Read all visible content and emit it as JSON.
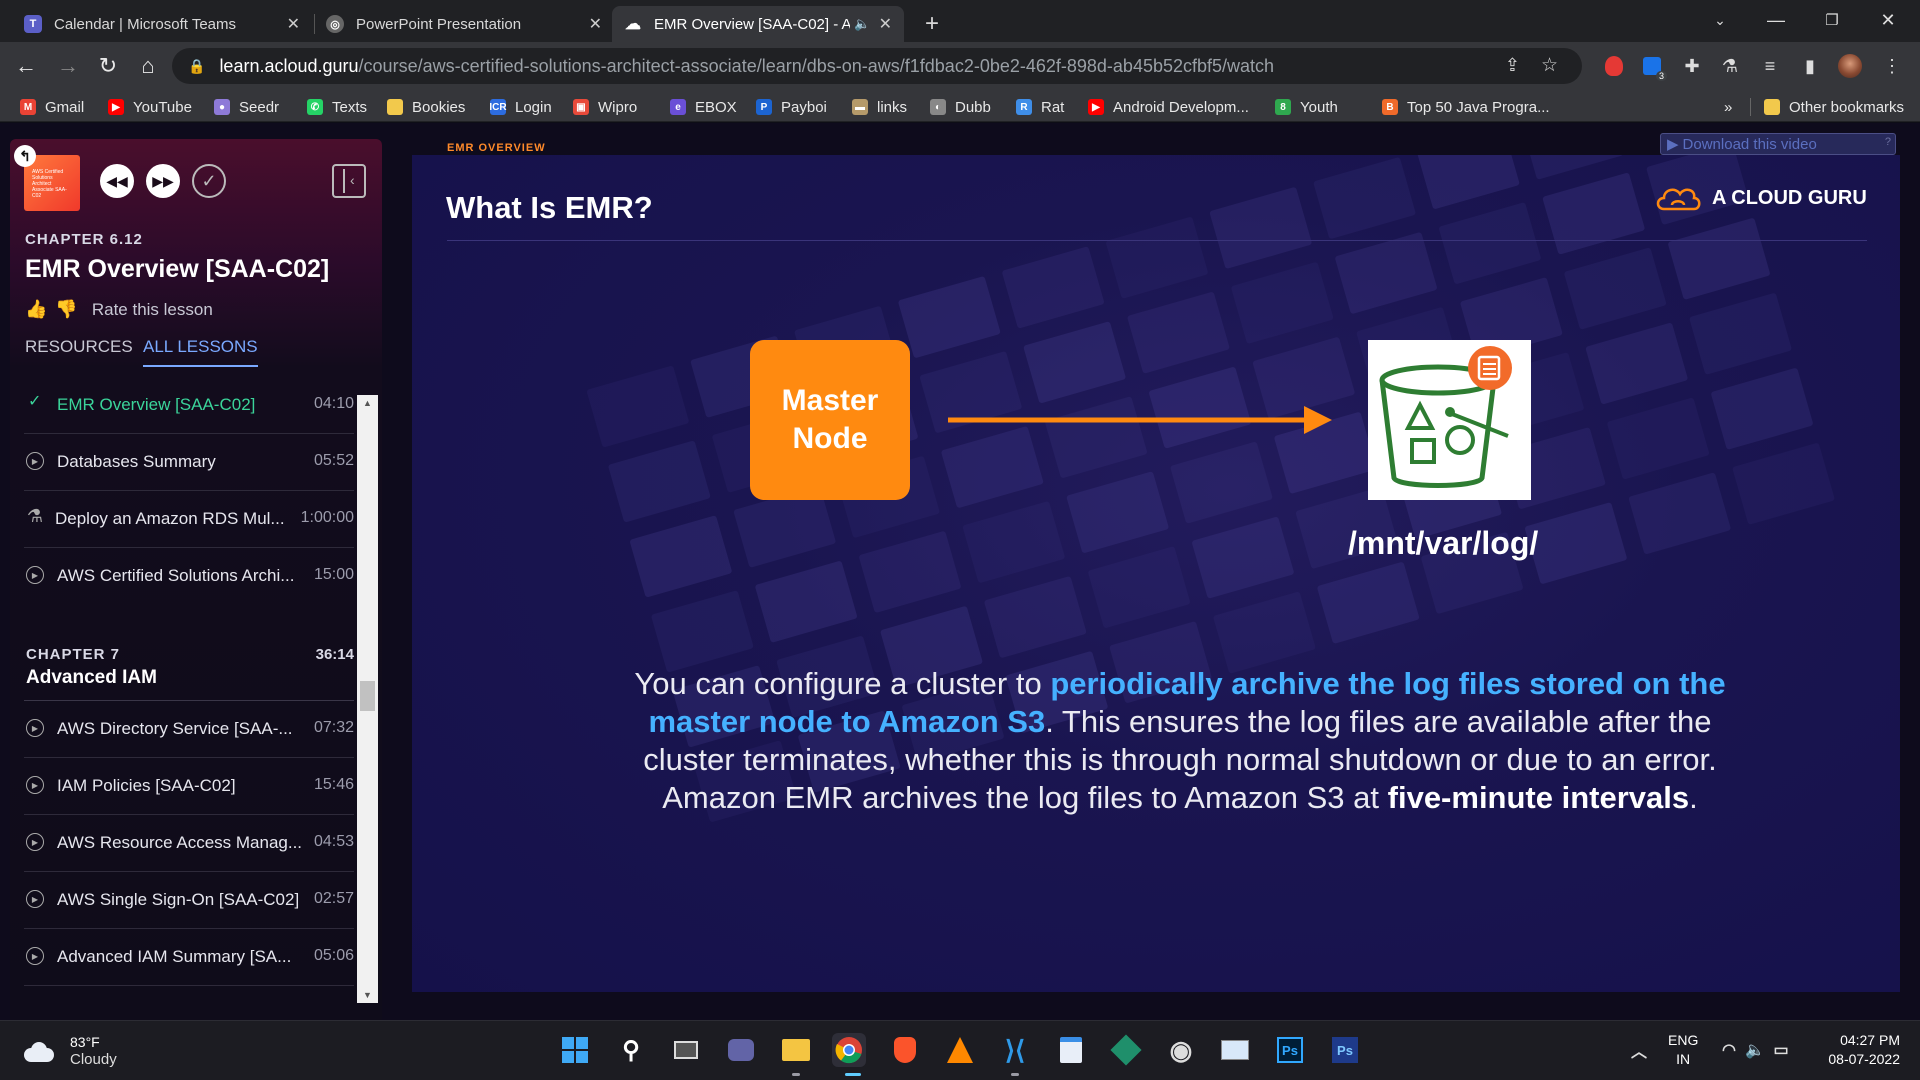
{
  "browser": {
    "tabs": [
      {
        "title": "Calendar | Microsoft Teams",
        "icon": "teams-icon",
        "color": "#5b5fc7"
      },
      {
        "title": "PowerPoint Presentation",
        "icon": "globe-icon",
        "color": "#777777"
      },
      {
        "title": "EMR Overview [SAA-C02] - A",
        "icon": "cloud-icon",
        "color": "#ffffff"
      }
    ],
    "new_tab": "+",
    "url_host": "learn.acloud.guru",
    "url_path": "/course/aws-certified-solutions-architect-associate/learn/dbs-on-aws/f1fdbac2-0be2-462f-898d-ab45b52cfbf5/watch",
    "extension_badge": "3",
    "bookmarks": [
      {
        "label": "Gmail",
        "color": "#ea4335",
        "glyph": "M"
      },
      {
        "label": "YouTube",
        "color": "#ff0000",
        "glyph": "▶"
      },
      {
        "label": "Seedr",
        "color": "#8e7ad8",
        "glyph": "●"
      },
      {
        "label": "Texts",
        "color": "#25d366",
        "glyph": "✆"
      },
      {
        "label": "Bookies",
        "color": "#f2c94c",
        "glyph": ""
      },
      {
        "label": "Login",
        "color": "#2d6cdf",
        "glyph": "ICR"
      },
      {
        "label": "Wipro",
        "color": "#e84a3a",
        "glyph": "▣"
      },
      {
        "label": "EBOX",
        "color": "#6a4fd6",
        "glyph": "e"
      },
      {
        "label": "Payboi",
        "color": "#1c64d1",
        "glyph": "P"
      },
      {
        "label": "links",
        "color": "#b59a6a",
        "glyph": "▬"
      },
      {
        "label": "Dubb",
        "color": "#888888",
        "glyph": "◐"
      },
      {
        "label": "Rat",
        "color": "#3f8ee8",
        "glyph": "R"
      },
      {
        "label": "Android Developm...",
        "color": "#ff0000",
        "glyph": "▶"
      },
      {
        "label": "Youth",
        "color": "#2fa84f",
        "glyph": "8"
      },
      {
        "label": "Top 50 Java Progra...",
        "color": "#f06a2a",
        "glyph": "B"
      }
    ],
    "bookmarks_overflow": "»",
    "other_bookmarks": "Other bookmarks"
  },
  "sidebar": {
    "chapter": "CHAPTER 6.12",
    "lesson_title": "EMR Overview [SAA-C02]",
    "rate_label": "Rate this lesson",
    "tabs": {
      "resources": "RESOURCES",
      "all_lessons": "ALL LESSONS"
    },
    "lessons": [
      {
        "title": "EMR Overview [SAA-C02]",
        "time": "04:10",
        "state": "done"
      },
      {
        "title": "Databases Summary",
        "time": "05:52",
        "state": "video"
      },
      {
        "title": "Deploy an Amazon RDS Mul...",
        "time": "1:00:00",
        "state": "lab"
      },
      {
        "title": "AWS Certified Solutions Archi...",
        "time": "15:00",
        "state": "video"
      }
    ],
    "chapter7": {
      "label": "CHAPTER 7",
      "duration": "36:14",
      "name": "Advanced IAM"
    },
    "chapter7_lessons": [
      {
        "title": "AWS Directory Service [SAA-...",
        "time": "07:32"
      },
      {
        "title": "IAM Policies [SAA-C02]",
        "time": "15:46"
      },
      {
        "title": "AWS Resource Access Manag...",
        "time": "04:53"
      },
      {
        "title": "AWS Single Sign-On [SAA-C02]",
        "time": "02:57"
      },
      {
        "title": "Advanced IAM Summary [SA...",
        "time": "05:06"
      }
    ]
  },
  "video": {
    "download_label": "Download this video",
    "download_help": "?",
    "eyebrow": "EMR OVERVIEW",
    "title": "What Is EMR?",
    "brand": "A CLOUD GURU",
    "master_node": "Master Node",
    "s3_path": "/mnt/var/log/",
    "body_1": "You can configure a cluster to ",
    "body_hl": "periodically archive the log files stored on the master node to Amazon S3",
    "body_2": ". This ensures the log files are available after the cluster terminates, whether this is through normal shutdown or due to an error. Amazon EMR archives the log files to Amazon S3 at ",
    "body_bold": "five-minute intervals",
    "body_3": ".",
    "accent_orange": "#ff8a10",
    "accent_blue": "#45b1ff"
  },
  "taskbar": {
    "temp": "83°F",
    "condition": "Cloudy",
    "lang": "ENG",
    "region": "IN",
    "time": "04:27 PM",
    "date": "08-07-2022"
  }
}
